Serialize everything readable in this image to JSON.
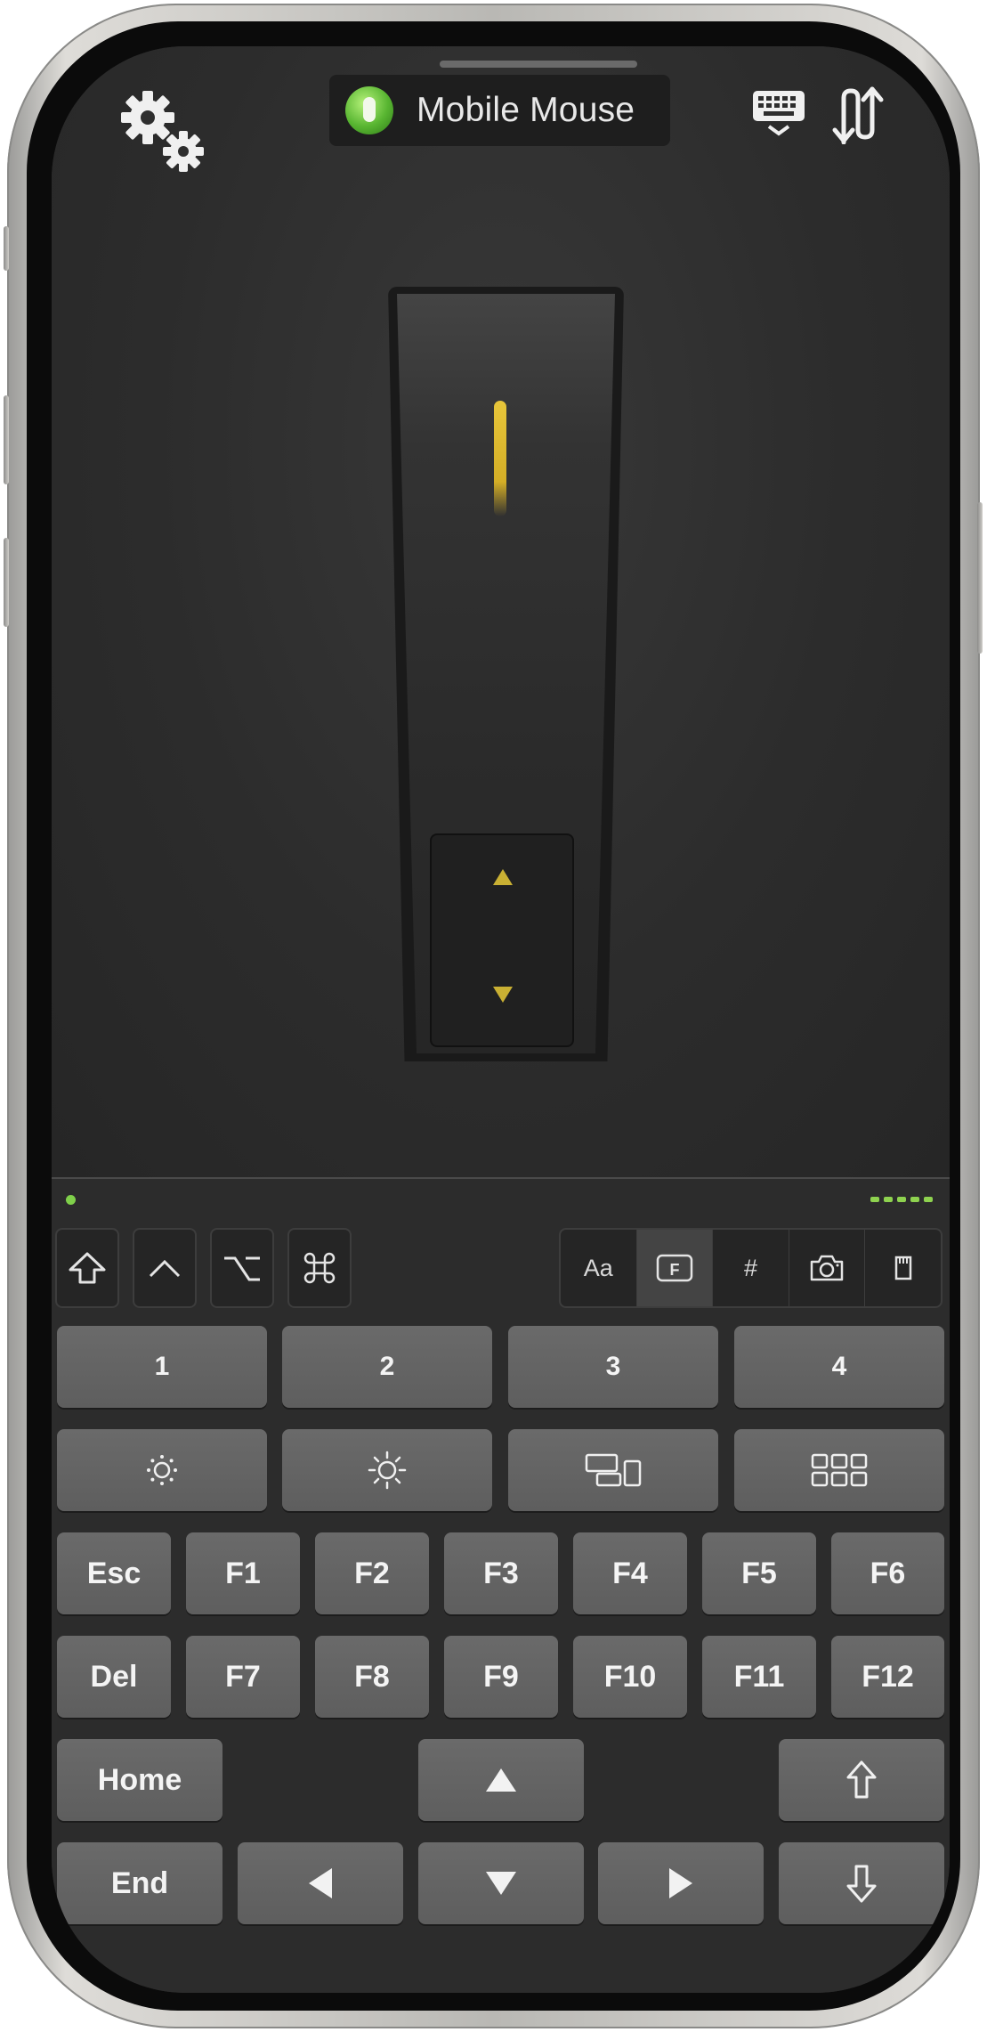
{
  "app": {
    "title": "Mobile Mouse",
    "connection_status_color": "#58b531"
  },
  "toolbar": {
    "settings_icon": "gears-icon",
    "keyboard_icon": "keyboard-icon",
    "switch_icon": "switch-arrows-icon"
  },
  "scroll_wheel": {
    "accent_color": "#d4ae26",
    "up_icon": "triangle-up-icon",
    "down_icon": "triangle-down-icon"
  },
  "modifiers": [
    {
      "name": "shift",
      "icon": "shift-icon"
    },
    {
      "name": "control",
      "icon": "control-caret-icon"
    },
    {
      "name": "option",
      "icon": "option-icon"
    },
    {
      "name": "command",
      "icon": "command-icon"
    }
  ],
  "modes": [
    {
      "label": "Aa",
      "active": false
    },
    {
      "label": "F",
      "active": true,
      "icon": "function-key-icon"
    },
    {
      "label": "#",
      "active": false
    },
    {
      "label": "",
      "active": false,
      "icon": "camera-icon"
    },
    {
      "label": "",
      "active": false,
      "icon": "sd-card-icon"
    }
  ],
  "keys": {
    "row1": [
      "1",
      "2",
      "3",
      "4"
    ],
    "row2_icons": [
      "brightness-down-icon",
      "brightness-up-icon",
      "mission-control-icon",
      "launchpad-grid-icon"
    ],
    "row3": [
      "Esc",
      "F1",
      "F2",
      "F3",
      "F4",
      "F5",
      "F6"
    ],
    "row4": [
      "Del",
      "F7",
      "F8",
      "F9",
      "F10",
      "F11",
      "F12"
    ],
    "home": "Home",
    "end": "End",
    "arrows": [
      "arrow-up-icon",
      "arrow-left-icon",
      "arrow-down-icon",
      "arrow-right-icon"
    ],
    "page_up_icon": "page-up-arrow-icon",
    "page_down_icon": "page-down-arrow-icon"
  }
}
